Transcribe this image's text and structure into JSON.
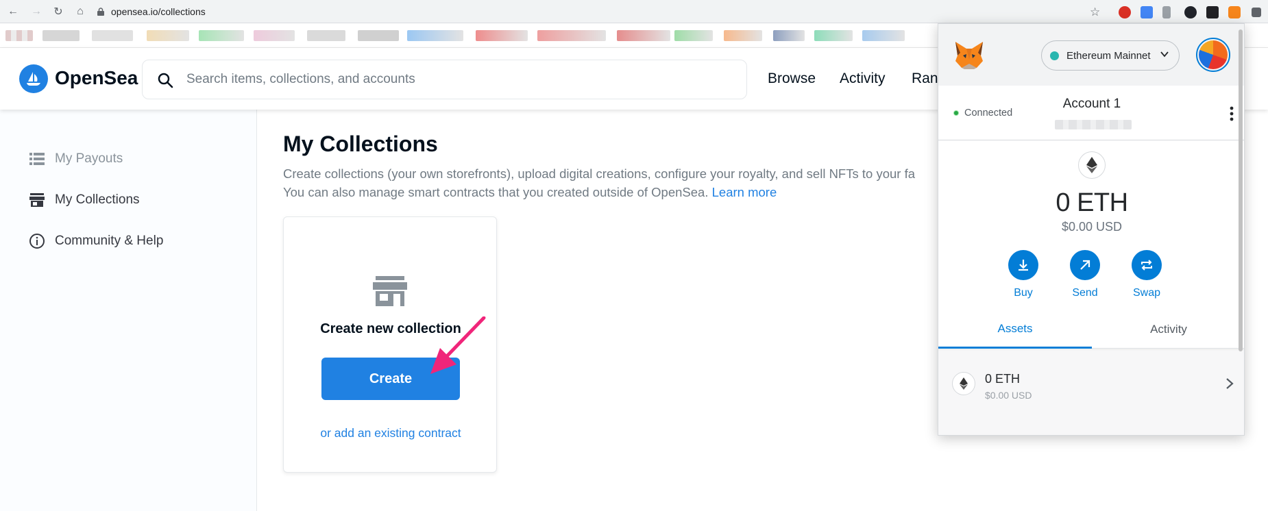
{
  "browser": {
    "url": "opensea.io/collections"
  },
  "opensea": {
    "brand": "OpenSea",
    "search_placeholder": "Search items, collections, and accounts",
    "nav": [
      "Browse",
      "Activity",
      "Rank"
    ]
  },
  "sidebar": {
    "items": [
      {
        "label": "My Payouts",
        "icon": "list-icon"
      },
      {
        "label": "My Collections",
        "icon": "store-icon"
      },
      {
        "label": "Community & Help",
        "icon": "info-icon"
      }
    ]
  },
  "main": {
    "title": "My Collections",
    "desc_line1": "Create collections (your own storefronts), upload digital creations, configure your royalty, and sell NFTs to your fa",
    "desc_line2": "You can also manage smart contracts that you created outside of OpenSea. ",
    "learn_more": "Learn more",
    "card": {
      "title": "Create new collection",
      "button": "Create",
      "link": "or add an existing contract"
    }
  },
  "metamask": {
    "network": "Ethereum Mainnet",
    "connected": "Connected",
    "account_name": "Account 1",
    "balance": "0 ETH",
    "balance_usd": "$0.00 USD",
    "actions": [
      "Buy",
      "Send",
      "Swap"
    ],
    "tabs": [
      "Assets",
      "Activity"
    ],
    "asset_amount": "0 ETH",
    "asset_usd": "$0.00 USD"
  },
  "colors": {
    "opensea_blue": "#2081e2",
    "metamask_blue": "#037dd6",
    "arrow_pink": "#f0257a"
  }
}
